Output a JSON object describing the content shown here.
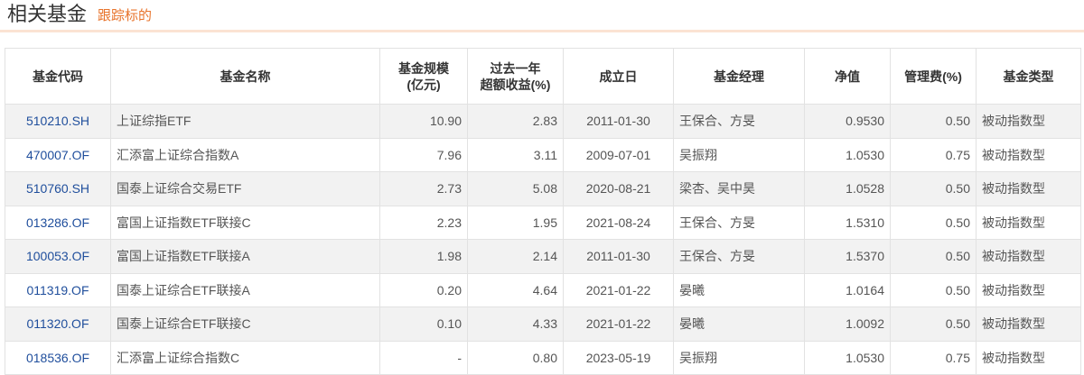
{
  "header": {
    "title": "相关基金",
    "subtitle": "跟踪标的"
  },
  "columns": [
    "基金代码",
    "基金名称",
    "基金规模\n(亿元)",
    "过去一年\n超额收益(%)",
    "成立日",
    "基金经理",
    "净值",
    "管理费(%)",
    "基金类型"
  ],
  "rows": [
    [
      "510210.SH",
      "上证综指ETF",
      "10.90",
      "2.83",
      "2011-01-30",
      "王保合、方旻",
      "0.9530",
      "0.50",
      "被动指数型"
    ],
    [
      "470007.OF",
      "汇添富上证综合指数A",
      "7.96",
      "3.11",
      "2009-07-01",
      "吴振翔",
      "1.0530",
      "0.75",
      "被动指数型"
    ],
    [
      "510760.SH",
      "国泰上证综合交易ETF",
      "2.73",
      "5.08",
      "2020-08-21",
      "梁杏、吴中昊",
      "1.0528",
      "0.50",
      "被动指数型"
    ],
    [
      "013286.OF",
      "富国上证指数ETF联接C",
      "2.23",
      "1.95",
      "2021-08-24",
      "王保合、方旻",
      "1.5310",
      "0.50",
      "被动指数型"
    ],
    [
      "100053.OF",
      "富国上证指数ETF联接A",
      "1.98",
      "2.14",
      "2011-01-30",
      "王保合、方旻",
      "1.5370",
      "0.50",
      "被动指数型"
    ],
    [
      "011319.OF",
      "国泰上证综合ETF联接A",
      "0.20",
      "4.64",
      "2021-01-22",
      "晏曦",
      "1.0164",
      "0.50",
      "被动指数型"
    ],
    [
      "011320.OF",
      "国泰上证综合ETF联接C",
      "0.10",
      "4.33",
      "2021-01-22",
      "晏曦",
      "1.0092",
      "0.50",
      "被动指数型"
    ],
    [
      "018536.OF",
      "汇添富上证综合指数C",
      "-",
      "0.80",
      "2023-05-19",
      "吴振翔",
      "1.0530",
      "0.75",
      "被动指数型"
    ]
  ]
}
